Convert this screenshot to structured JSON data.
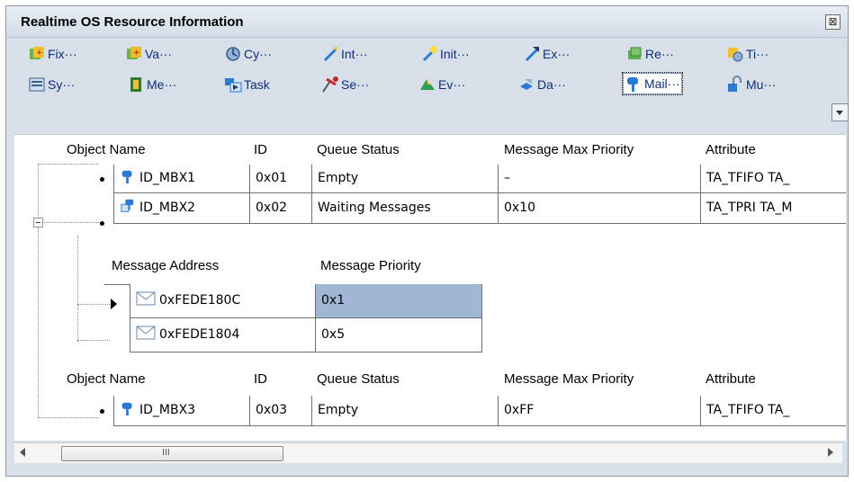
{
  "window": {
    "title": "Realtime OS Resource Information",
    "close_symbol": "⊠"
  },
  "toolbar": {
    "row1": [
      {
        "label": "Fix···",
        "icon": "fixed-memory-pool-icon"
      },
      {
        "label": "Va···",
        "icon": "variable-memory-pool-icon"
      },
      {
        "label": "Cy···",
        "icon": "cyclic-handler-icon"
      },
      {
        "label": "Int···",
        "icon": "interrupt-handler-icon"
      },
      {
        "label": "Init···",
        "icon": "initialize-routine-icon"
      },
      {
        "label": "Ex···",
        "icon": "exception-handler-icon"
      },
      {
        "label": "Re···",
        "icon": "ready-queue-icon"
      },
      {
        "label": "Ti···",
        "icon": "timer-icon"
      }
    ],
    "row2": [
      {
        "label": "Sy···",
        "icon": "system-status-icon"
      },
      {
        "label": "Me···",
        "icon": "memory-pool-icon"
      },
      {
        "label": "Task",
        "icon": "task-icon"
      },
      {
        "label": "Se···",
        "icon": "semaphore-icon"
      },
      {
        "label": "Ev···",
        "icon": "eventflag-icon"
      },
      {
        "label": "Da···",
        "icon": "data-queue-icon"
      },
      {
        "label": "Mail···",
        "icon": "mailbox-icon",
        "active": true
      },
      {
        "label": "Mu···",
        "icon": "mutex-icon"
      }
    ]
  },
  "table": {
    "headers": [
      "Object Name",
      "ID",
      "Queue Status",
      "Message Max Priority",
      "Attribute"
    ],
    "rows": [
      {
        "name": "ID_MBX1",
        "id": "0x01",
        "status": "Empty",
        "max_priority": "–",
        "attribute": "TA_TFIFO TA_"
      },
      {
        "name": "ID_MBX2",
        "id": "0x02",
        "status": "Waiting Messages",
        "max_priority": "0x10",
        "attribute": "TA_TPRI TA_M"
      }
    ],
    "sub_headers": [
      "Message Address",
      "Message Priority"
    ],
    "messages": [
      {
        "address": "0xFEDE180C",
        "priority": "0x1"
      },
      {
        "address": "0xFEDE1804",
        "priority": "0x5"
      }
    ],
    "headers2": [
      "Object Name",
      "ID",
      "Queue Status",
      "Message Max Priority",
      "Attribute"
    ],
    "rows2": [
      {
        "name": "ID_MBX3",
        "id": "0x03",
        "status": "Empty",
        "max_priority": "0xFF",
        "attribute": "TA_TFIFO TA_"
      }
    ]
  },
  "scrollbar": {
    "grip": "III"
  },
  "colors": {
    "toolbar_text": "#0d2f7a",
    "selected_cell": "#9fb6d5",
    "panel_bg": "#d7dfe8"
  }
}
